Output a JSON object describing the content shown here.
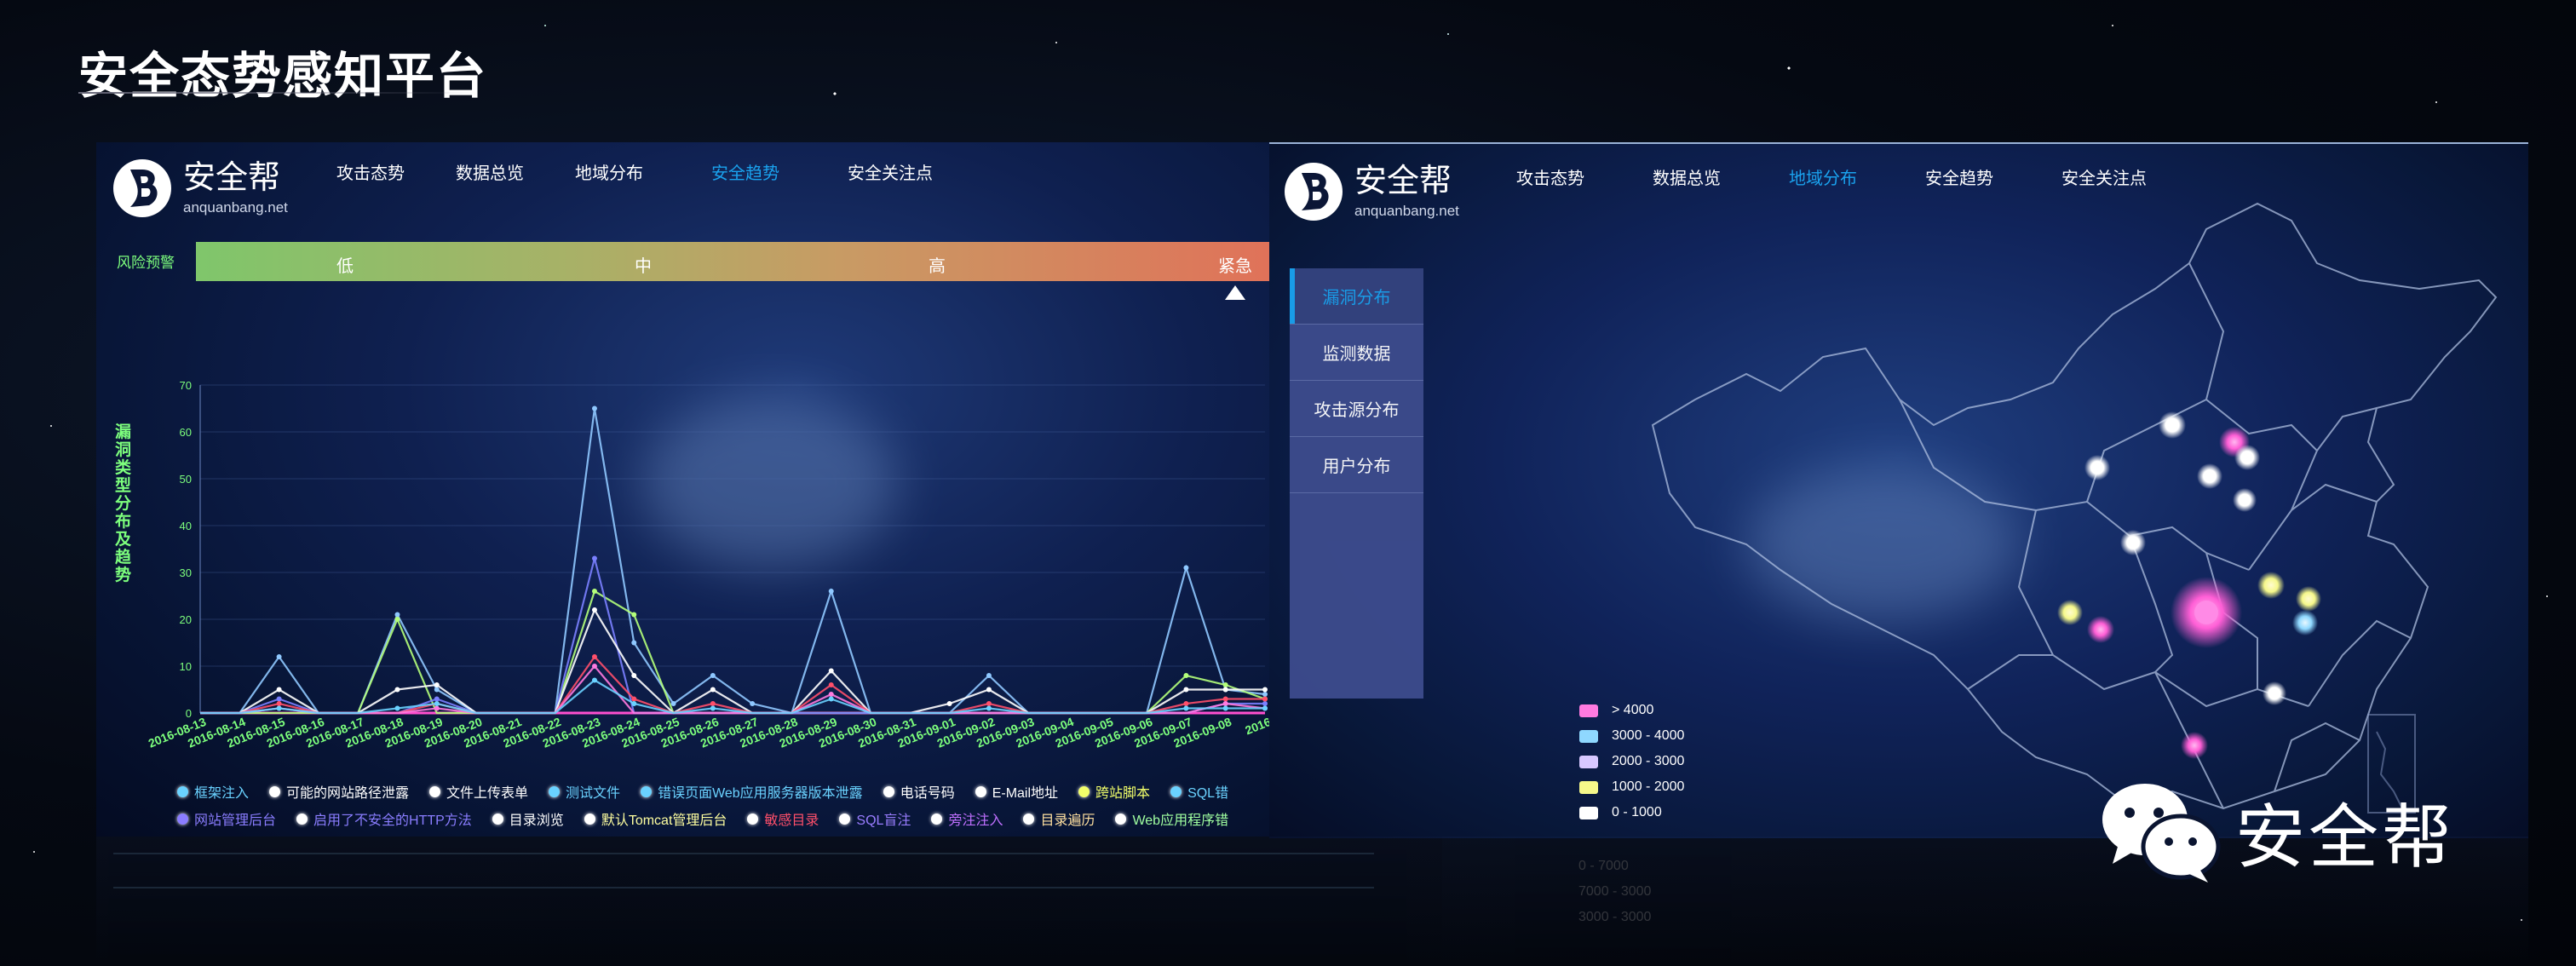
{
  "page_title": "安全态势感知平台",
  "brand": {
    "name": "安全帮",
    "domain": "anquanbang.net",
    "logo_letter": "B"
  },
  "left_panel": {
    "nav": [
      "攻击态势",
      "数据总览",
      "地域分布",
      "安全趋势",
      "安全关注点"
    ],
    "active_nav": "安全趋势",
    "risk": {
      "label": "风险预警",
      "levels": [
        "低",
        "中",
        "高",
        "紧急"
      ],
      "current_level": "紧急"
    },
    "y_axis_label": "漏洞类型分布及趋势",
    "legend_row1": [
      {
        "label": "框架注入",
        "color": "#6ad2ff"
      },
      {
        "label": "可能的网站路径泄露",
        "color": "#ffffff"
      },
      {
        "label": "文件上传表单",
        "color": "#ffffff"
      },
      {
        "label": "测试文件",
        "color": "#6ad2ff"
      },
      {
        "label": "错误页面Web应用服务器版本泄露",
        "color": "#6ad2ff"
      },
      {
        "label": "电话号码",
        "color": "#ffffff"
      },
      {
        "label": "E-Mail地址",
        "color": "#ffffff"
      },
      {
        "label": "跨站脚本",
        "color": "#f2ff6a"
      },
      {
        "label": "SQL错",
        "color": "#6ad2ff"
      }
    ],
    "legend_row2": [
      {
        "label": "网站管理后台",
        "color": "#8a7dff"
      },
      {
        "label": "启用了不安全的HTTP方法",
        "color": "#8a7dff"
      },
      {
        "label": "目录浏览",
        "color": "#ffffff"
      },
      {
        "label": "默认Tomcat管理后台",
        "color": "#ffffa0"
      },
      {
        "label": "敏感目录",
        "color": "#ff4f6a"
      },
      {
        "label": "SQL盲注",
        "color": "#9a7dff"
      },
      {
        "label": "旁注注入",
        "color": "#c070ff"
      },
      {
        "label": "目录遍历",
        "color": "#ffe0a0"
      },
      {
        "label": "Web应用程序错",
        "color": "#a0ffa0"
      }
    ]
  },
  "chart_data": {
    "type": "line",
    "ylim": [
      0,
      70
    ],
    "yticks": [
      0,
      10,
      20,
      30,
      40,
      50,
      60,
      70
    ],
    "x": [
      "2016-08-13",
      "2016-08-14",
      "2016-08-15",
      "2016-08-16",
      "2016-08-17",
      "2016-08-18",
      "2016-08-19",
      "2016-08-20",
      "2016-08-21",
      "2016-08-22",
      "2016-08-23",
      "2016-08-24",
      "2016-08-25",
      "2016-08-26",
      "2016-08-27",
      "2016-08-28",
      "2016-08-29",
      "2016-08-30",
      "2016-08-31",
      "2016-09-01",
      "2016-09-02",
      "2016-09-03",
      "2016-09-04",
      "2016-09-05",
      "2016-09-06",
      "2016-09-07",
      "2016-09-08",
      "2016"
    ],
    "series": [
      {
        "color": "#8fc8ff",
        "values": [
          0,
          0,
          12,
          0,
          0,
          21,
          5,
          0,
          0,
          0,
          65,
          15,
          2,
          8,
          2,
          0,
          26,
          0,
          0,
          0,
          8,
          0,
          0,
          0,
          0,
          31,
          5,
          4
        ]
      },
      {
        "color": "#b4ff7a",
        "values": [
          0,
          0,
          0,
          0,
          0,
          20,
          0,
          0,
          0,
          0,
          26,
          21,
          0,
          0,
          0,
          0,
          0,
          0,
          0,
          0,
          0,
          0,
          0,
          0,
          0,
          8,
          6,
          3
        ]
      },
      {
        "color": "#7a80ff",
        "values": [
          0,
          0,
          3,
          0,
          0,
          0,
          3,
          0,
          0,
          0,
          33,
          0,
          0,
          0,
          0,
          0,
          0,
          0,
          0,
          0,
          0,
          0,
          0,
          0,
          0,
          0,
          2,
          2
        ]
      },
      {
        "color": "#ffffff",
        "values": [
          0,
          0,
          5,
          0,
          0,
          5,
          6,
          0,
          0,
          0,
          22,
          8,
          0,
          5,
          0,
          0,
          9,
          0,
          0,
          2,
          5,
          0,
          0,
          0,
          0,
          5,
          5,
          5
        ]
      },
      {
        "color": "#ff4f6a",
        "values": [
          0,
          0,
          2,
          0,
          0,
          0,
          2,
          0,
          0,
          0,
          12,
          3,
          0,
          2,
          0,
          0,
          6,
          0,
          0,
          0,
          2,
          0,
          0,
          0,
          0,
          2,
          3,
          3
        ]
      },
      {
        "color": "#ff7adf",
        "values": [
          0,
          0,
          1,
          0,
          0,
          0,
          1,
          0,
          0,
          0,
          10,
          0,
          0,
          0,
          0,
          0,
          4,
          0,
          0,
          0,
          0,
          0,
          0,
          0,
          0,
          0,
          2,
          1
        ]
      },
      {
        "color": "#6ad2ff",
        "values": [
          0,
          0,
          1,
          0,
          0,
          1,
          2,
          0,
          0,
          0,
          7,
          2,
          0,
          1,
          0,
          0,
          3,
          0,
          0,
          0,
          1,
          0,
          0,
          0,
          0,
          1,
          1,
          1
        ]
      }
    ]
  },
  "right_panel": {
    "nav": [
      "攻击态势",
      "数据总览",
      "地域分布",
      "安全趋势",
      "安全关注点"
    ],
    "active_nav": "地域分布",
    "side_menu": [
      "漏洞分布",
      "监测数据",
      "攻击源分布",
      "用户分布"
    ],
    "active_menu": "漏洞分布",
    "map_legend": [
      {
        "label": "> 4000",
        "color": "#ff7adf"
      },
      {
        "label": "3000 - 4000",
        "color": "#8fd8ff"
      },
      {
        "label": "2000 - 3000",
        "color": "#d8c8ff"
      },
      {
        "label": "1000 - 2000",
        "color": "#f6f88a"
      },
      {
        "label": "0 - 1000",
        "color": "#ffffff"
      }
    ]
  },
  "watermark": {
    "text": "安全帮"
  },
  "reflection_legend": [
    "0 - 7000",
    "7000 - 3000",
    "3000 - 3000"
  ]
}
